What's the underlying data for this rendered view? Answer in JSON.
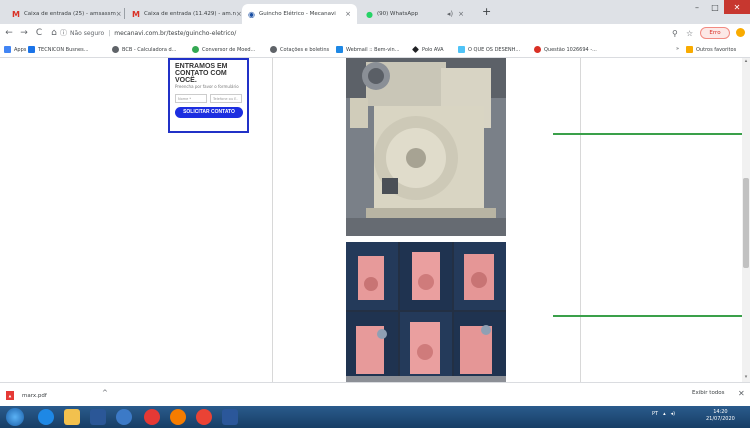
{
  "tabs": [
    {
      "label": "Caixa de entrada (25) - amsassm",
      "favicon": "gmail-icon",
      "active": false
    },
    {
      "label": "Caixa de entrada (11.429) - am.n",
      "favicon": "gmail-icon",
      "active": false
    },
    {
      "label": "Guincho Elétrico - Mecanavi",
      "favicon": "mecanavi-icon",
      "active": true
    },
    {
      "label": "(90) WhatsApp",
      "favicon": "whatsapp-icon",
      "active": false
    }
  ],
  "toolbar": {
    "insecure_label": "Não seguro",
    "url": "mecanavi.com.br/teste/guincho-eletrico/",
    "profile_label": "Erro"
  },
  "bookmarks": [
    {
      "label": "Apps",
      "color": "#4285f4"
    },
    {
      "label": "TECNICON Busnes...",
      "color": "#1a73e8"
    },
    {
      "label": "BCB - Calculadora d...",
      "color": "#5f6368"
    },
    {
      "label": "Conversor de Moed...",
      "color": "#34a853"
    },
    {
      "label": "Cotações e boletins",
      "color": "#5f6368"
    },
    {
      "label": "Webmail :: Bem-vin...",
      "color": "#1e88e5"
    },
    {
      "label": "Polo AVA",
      "color": "#202124"
    },
    {
      "label": "O QUE OS DESENH...",
      "color": "#4fc3f7"
    },
    {
      "label": "Questão 1026694 -...",
      "color": "#d93025"
    },
    {
      "label": "Outros favoritos",
      "color": "#f9ab00"
    }
  ],
  "form": {
    "title": "ENTRAMOS EM CONTATO COM VOCÊ.",
    "subtitle": "Preencha por favor o formulário",
    "name_placeholder": "Nome *",
    "phone_placeholder": "Telefone ou E-",
    "button_label": "SOLICITAR CONTATO"
  },
  "downloads": {
    "file": "marx.pdf",
    "show_all": "Exibir todos"
  },
  "taskbar": {
    "lang": "PT",
    "time": "14:20",
    "date": "21/07/2020"
  },
  "colors": {
    "form_border": "#2131c7",
    "form_button": "#1c2ee0",
    "guide_line": "#3aa04a"
  }
}
